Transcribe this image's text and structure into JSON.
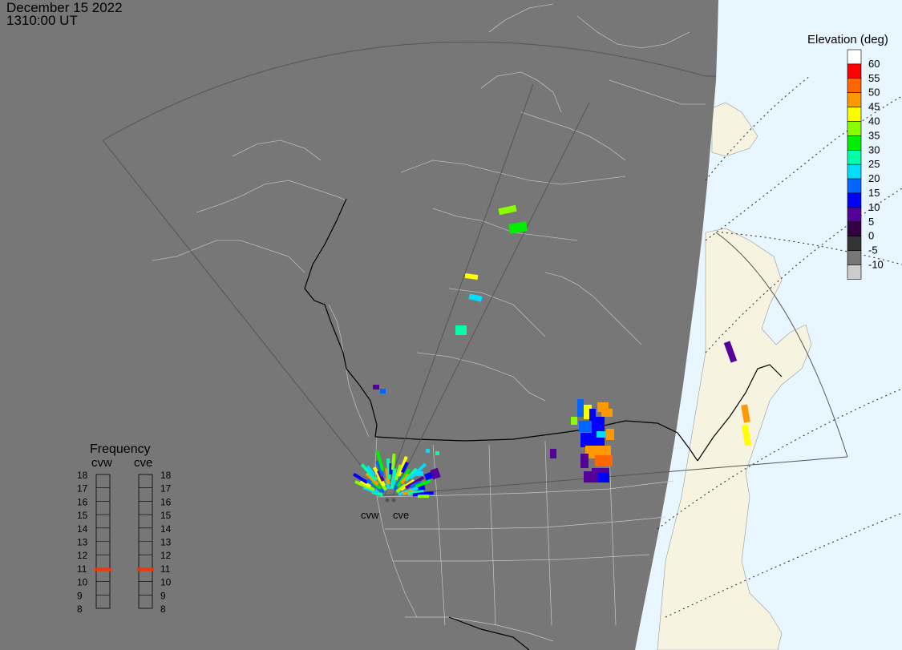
{
  "header": {
    "date": "December 15 2022",
    "time": "1310:00 UT"
  },
  "radars": [
    {
      "id": "cvw",
      "label": "cvw"
    },
    {
      "id": "cve",
      "label": "cve"
    }
  ],
  "elevation_legend": {
    "title": "Elevation (deg)",
    "levels": [
      {
        "value": "60",
        "color": "#ffffff"
      },
      {
        "value": "55",
        "color": "#ff0000"
      },
      {
        "value": "50",
        "color": "#ff6600"
      },
      {
        "value": "45",
        "color": "#ff9900"
      },
      {
        "value": "40",
        "color": "#ffff00"
      },
      {
        "value": "35",
        "color": "#88ff00"
      },
      {
        "value": "30",
        "color": "#00ee00"
      },
      {
        "value": "25",
        "color": "#00ffaa"
      },
      {
        "value": "20",
        "color": "#00ddff"
      },
      {
        "value": "15",
        "color": "#0066ff"
      },
      {
        "value": "10",
        "color": "#0000ff"
      },
      {
        "value": "5",
        "color": "#550099"
      },
      {
        "value": "0",
        "color": "#330044"
      },
      {
        "value": "-5",
        "color": "#333333"
      },
      {
        "value": "-10",
        "color": "#777777"
      },
      {
        "value": "",
        "color": "#cccccc"
      }
    ]
  },
  "frequency_legend": {
    "title": "Frequency",
    "columns": [
      "cvw",
      "cve"
    ],
    "labels": [
      "18",
      "17",
      "16",
      "15",
      "14",
      "13",
      "12",
      "11",
      "10",
      "9",
      "8"
    ],
    "current_mhz": {
      "cvw": 10.9,
      "cve": 10.9
    }
  },
  "colors": {
    "night": "#777777",
    "day_land": "#f7f3e1",
    "day_ocean": "#e8f6ff",
    "grid": "#bdbdbd",
    "fov": "#555555",
    "freq_marker": "#ff3300"
  }
}
